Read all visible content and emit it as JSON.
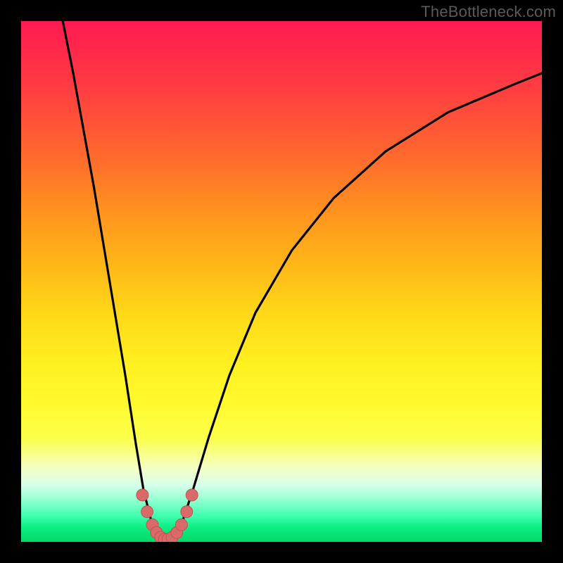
{
  "watermark": {
    "text": "TheBottleneck.com"
  },
  "colors": {
    "background": "#000000",
    "curve": "#000000",
    "marker_fill": "#d96a6a",
    "marker_stroke": "#c85050"
  },
  "chart_data": {
    "type": "line",
    "title": "",
    "xlabel": "",
    "ylabel": "",
    "xlim": [
      0,
      100
    ],
    "ylim": [
      0,
      100
    ],
    "series": [
      {
        "name": "left-curve",
        "x": [
          8,
          10,
          12,
          14,
          16,
          18,
          20,
          22,
          23.5,
          25,
          26,
          27
        ],
        "y": [
          100,
          90,
          79,
          68,
          56,
          44,
          32,
          19,
          10,
          4,
          1.5,
          0.5
        ]
      },
      {
        "name": "right-curve",
        "x": [
          29,
          30,
          31,
          33,
          36,
          40,
          45,
          52,
          60,
          70,
          82,
          95,
          100
        ],
        "y": [
          0.5,
          1.5,
          4,
          10,
          20,
          32,
          44,
          56,
          66,
          75,
          82.5,
          88,
          90
        ]
      },
      {
        "name": "valley-markers",
        "x": [
          23.3,
          24.2,
          25.2,
          26.0,
          26.8,
          27.5,
          28.2,
          29.0,
          29.9,
          30.8,
          31.8,
          32.8
        ],
        "y": [
          9.0,
          5.8,
          3.3,
          1.8,
          0.9,
          0.5,
          0.5,
          0.9,
          1.8,
          3.3,
          5.8,
          9.0
        ]
      }
    ],
    "gradient_stops": [
      {
        "pct": 0,
        "color": "#ff1a52"
      },
      {
        "pct": 14,
        "color": "#ff4040"
      },
      {
        "pct": 36,
        "color": "#ff9020"
      },
      {
        "pct": 56,
        "color": "#ffd818"
      },
      {
        "pct": 74,
        "color": "#fffb30"
      },
      {
        "pct": 89,
        "color": "#d8ffea"
      },
      {
        "pct": 97,
        "color": "#10f088"
      },
      {
        "pct": 100,
        "color": "#05d868"
      }
    ]
  }
}
